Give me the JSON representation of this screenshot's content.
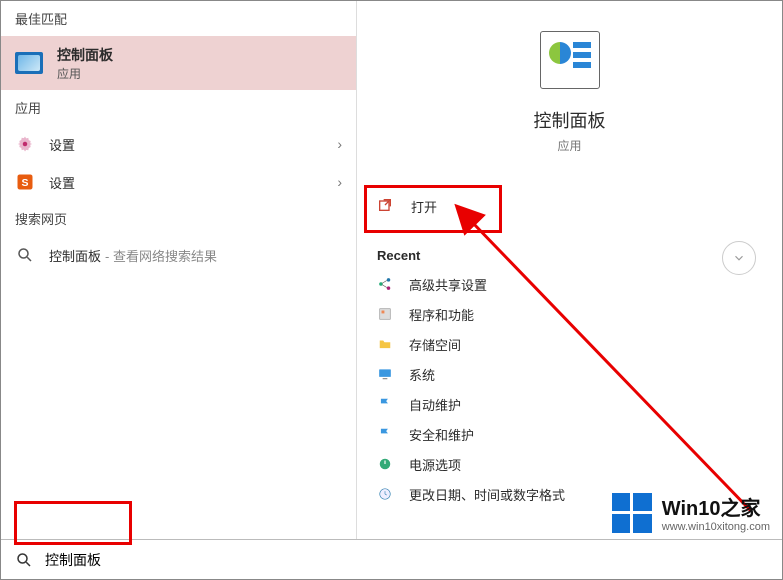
{
  "left": {
    "best_match_header": "最佳匹配",
    "best_match": {
      "title": "控制面板",
      "subtitle": "应用"
    },
    "apps_header": "应用",
    "apps": [
      {
        "label": "设置"
      },
      {
        "label": "设置"
      }
    ],
    "web_header": "搜索网页",
    "web": {
      "label": "控制面板",
      "suffix": " - 查看网络搜索结果"
    }
  },
  "right": {
    "hero_title": "控制面板",
    "hero_sub": "应用",
    "open_label": "打开",
    "recent_header": "Recent",
    "recent": [
      {
        "icon": "share",
        "label": "高级共享设置"
      },
      {
        "icon": "program",
        "label": "程序和功能"
      },
      {
        "icon": "folder",
        "label": "存储空间"
      },
      {
        "icon": "system",
        "label": "系统"
      },
      {
        "icon": "flag",
        "label": "自动维护"
      },
      {
        "icon": "flag",
        "label": "安全和维护"
      },
      {
        "icon": "power",
        "label": "电源选项"
      },
      {
        "icon": "clock",
        "label": "更改日期、时间或数字格式"
      }
    ]
  },
  "search": {
    "value": "控制面板"
  },
  "watermark": {
    "title": "Win10之家",
    "url": "www.win10xitong.com"
  },
  "annotations": {
    "open_box": true,
    "search_box": true,
    "arrow": true
  }
}
